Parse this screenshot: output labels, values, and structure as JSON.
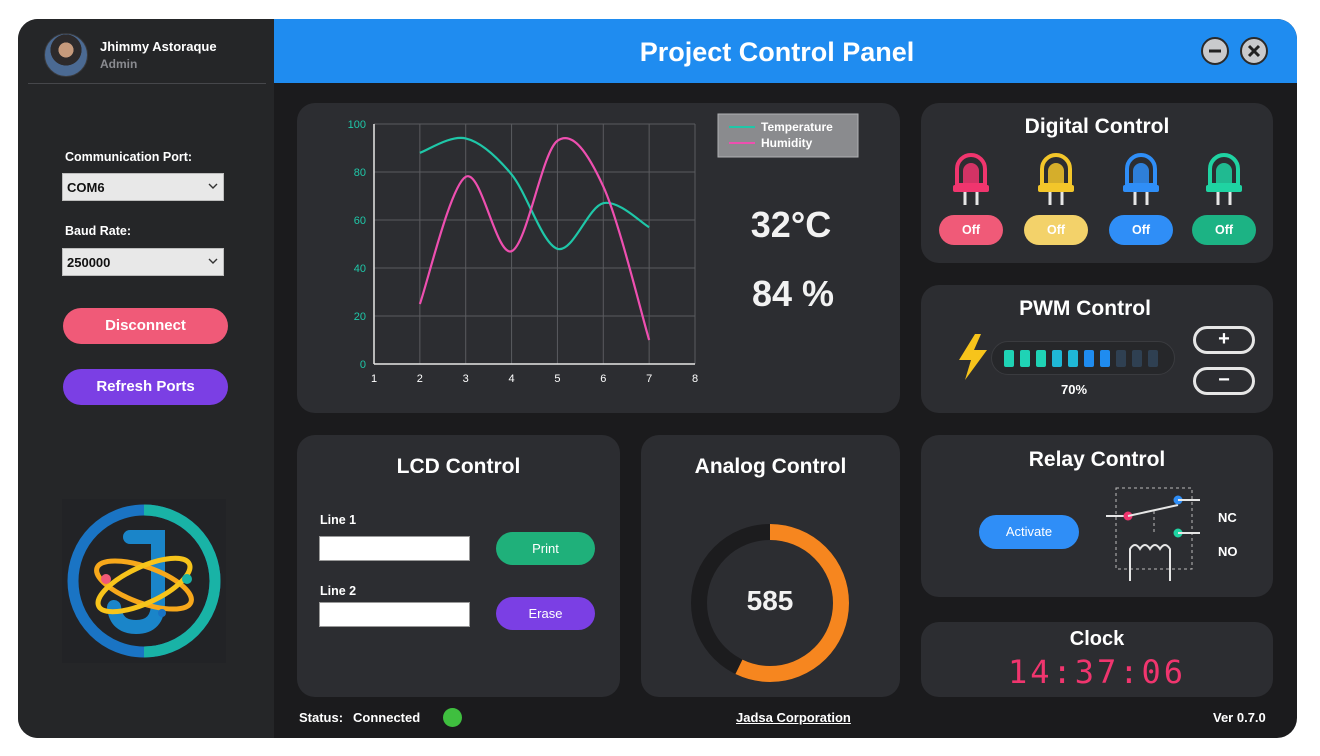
{
  "user": {
    "name": "Jhimmy Astoraque",
    "role": "Admin"
  },
  "sidebar": {
    "port_label": "Communication Port:",
    "port_value": "COM6",
    "baud_label": "Baud Rate:",
    "baud_value": "250000",
    "disconnect_label": "Disconnect",
    "refresh_label": "Refresh Ports",
    "logo_icon": "jadsa-atom-logo-icon"
  },
  "header": {
    "title": "Project Control Panel",
    "minimize_icon": "minimize-icon",
    "close_icon": "close-icon"
  },
  "chart_data": {
    "type": "line",
    "x": [
      2,
      3,
      4,
      5,
      6,
      7
    ],
    "xlim": [
      1,
      8
    ],
    "ylim": [
      0,
      100
    ],
    "xticks": [
      "1",
      "2",
      "3",
      "4",
      "5",
      "6",
      "7",
      "8"
    ],
    "yticks": [
      "0",
      "20",
      "40",
      "60",
      "80",
      "100"
    ],
    "grid": true,
    "legend_position": "top-right",
    "series": [
      {
        "name": "Temperature",
        "color": "#1fc7a8",
        "values": [
          88,
          94,
          79,
          48,
          67,
          57
        ]
      },
      {
        "name": "Humidity",
        "color": "#ee4fb0",
        "values": [
          25,
          78,
          47,
          93,
          74,
          10
        ]
      }
    ]
  },
  "readings": {
    "temperature": "32°C",
    "humidity": "84 %"
  },
  "digital": {
    "title": "Digital Control",
    "leds": [
      {
        "label": "Off",
        "color": "#f0356e",
        "button_color": "#f05a78"
      },
      {
        "label": "Off",
        "color": "#f3c62a",
        "button_color": "#f3d26a"
      },
      {
        "label": "Off",
        "color": "#2f8ef7",
        "button_color": "#2f8ef7"
      },
      {
        "label": "Off",
        "color": "#1fd3a2",
        "button_color": "#1cb384"
      }
    ]
  },
  "pwm": {
    "title": "PWM Control",
    "value_label": "70%",
    "level": 0.7,
    "plus_label": "+",
    "minus_label": "−"
  },
  "lcd": {
    "title": "LCD Control",
    "line1_label": "Line 1",
    "line1_value": "",
    "line2_label": "Line 2",
    "line2_value": "",
    "print_label": "Print",
    "erase_label": "Erase"
  },
  "analog": {
    "title": "Analog Control",
    "value": "585",
    "max": 1023
  },
  "relay": {
    "title": "Relay Control",
    "activate_label": "Activate",
    "nc_label": "NC",
    "no_label": "NO"
  },
  "clock": {
    "title": "Clock",
    "time": "14:37:06"
  },
  "footer": {
    "status_label": "Status:",
    "status_value": "Connected",
    "status_color": "#3fbf3f",
    "company": "Jadsa Corporation",
    "version": "Ver 0.7.0"
  }
}
